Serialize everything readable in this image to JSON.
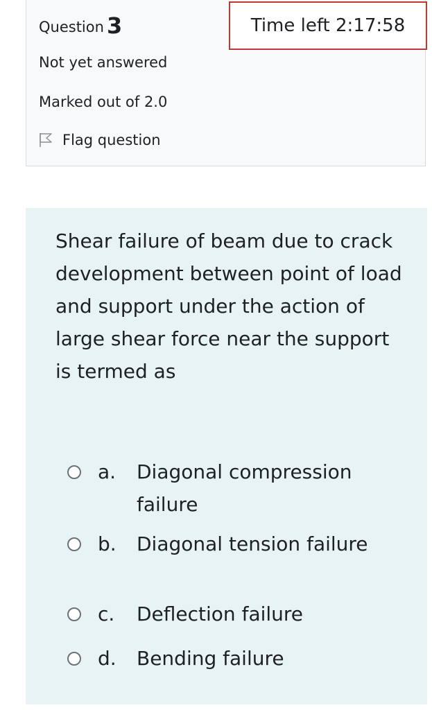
{
  "info": {
    "question_label": "Question",
    "question_number": "3",
    "state": "Not yet answered",
    "grade": "Marked out of 2.0",
    "flag_label": "Flag question"
  },
  "timer": {
    "text": "Time left 2:17:58",
    "border_color": "#c0392b"
  },
  "question": {
    "text": "Shear failure of beam due to crack development between point of load and support under the action of large shear force near the support is termed as",
    "background_color": "#e7f3f5",
    "answers": [
      {
        "letter": "a.",
        "text": "Diagonal compression failure"
      },
      {
        "letter": "b.",
        "text": "Diagonal tension failure"
      },
      {
        "letter": "c.",
        "text": "Deflection failure"
      },
      {
        "letter": "d.",
        "text": "Bending failure"
      }
    ]
  },
  "icons": {
    "flag": "flag-icon",
    "radio": "radio-circle"
  }
}
